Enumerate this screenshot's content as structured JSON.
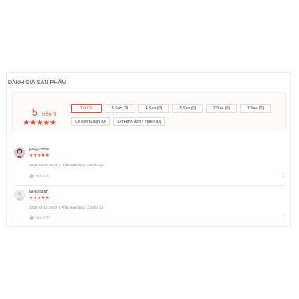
{
  "section": {
    "title": "ĐÁNH GIÁ SẢN PHẨM"
  },
  "summary": {
    "score": "5",
    "score_suffix": "trên 5",
    "stars": "★★★★★",
    "filters": [
      "Tất Cả",
      "5 Sao (2)",
      "4 Sao (0)",
      "3 Sao (0)",
      "2 Sao (0)",
      "1 Sao (0)",
      "Có Bình Luận (0)",
      "Có Hình Ảnh / Video (0)"
    ]
  },
  "reviews": [
    {
      "username": "jenny13708",
      "stars": "★★★★★",
      "meta": "2026-01-09 16:16 | Phân loại hàng: Combo 12",
      "helpful": "Hữu ích?",
      "more": "⋮"
    },
    {
      "username": "tamtom457",
      "stars": "★★★★★",
      "meta": "2026-01-15 16:46 | Phân loại hàng: Combo 12",
      "helpful": "Hữu ích?",
      "more": "⋮"
    }
  ],
  "colors": {
    "accent": "#ee4d2d",
    "summary_bg": "#fffbf8"
  },
  "icons": {
    "like": "thumbs-up-icon",
    "more": "more-vertical-icon"
  }
}
